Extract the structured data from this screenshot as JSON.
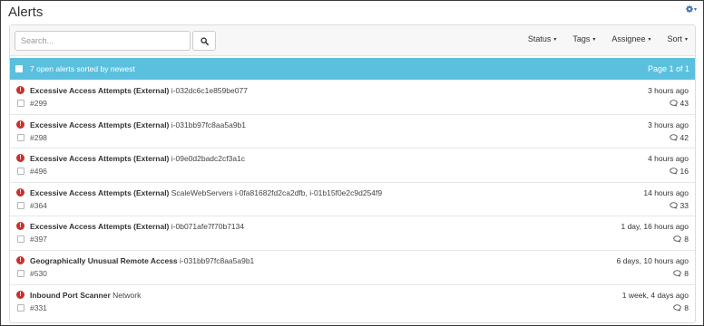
{
  "page": {
    "title": "Alerts"
  },
  "settings": {
    "icon": "gear-icon",
    "color": "#3b6fa8"
  },
  "toolbar": {
    "search_placeholder": "Search...",
    "search_icon": "search-icon",
    "filters": [
      "Status",
      "Tags",
      "Assignee",
      "Sort"
    ]
  },
  "summary": {
    "text": "7 open alerts sorted by newest",
    "page_info": "Page 1 of 1",
    "color": "#5bc0de"
  },
  "alerts": [
    {
      "name": "Excessive Access Attempts (External)",
      "detail": "i-032dc6c1e859be077",
      "number": "#299",
      "time": "3 hours ago",
      "comments": "43"
    },
    {
      "name": "Excessive Access Attempts (External)",
      "detail": "i-031bb97fc8aa5a9b1",
      "number": "#298",
      "time": "3 hours ago",
      "comments": "42"
    },
    {
      "name": "Excessive Access Attempts (External)",
      "detail": "i-09e0d2badc2cf3a1c",
      "number": "#496",
      "time": "4 hours ago",
      "comments": "16"
    },
    {
      "name": "Excessive Access Attempts (External)",
      "detail": "ScaleWebServers i-0fa81682fd2ca2dfb, i-01b15f0e2c9d254f9",
      "number": "#364",
      "time": "14 hours ago",
      "comments": "33"
    },
    {
      "name": "Excessive Access Attempts (External)",
      "detail": "i-0b071afe7f70b7134",
      "number": "#397",
      "time": "1 day, 16 hours ago",
      "comments": "8"
    },
    {
      "name": "Geographically Unusual Remote Access",
      "detail": "i-031bb97fc8aa5a9b1",
      "number": "#530",
      "time": "6 days, 10 hours ago",
      "comments": "8"
    },
    {
      "name": "Inbound Port Scanner",
      "detail": "Network",
      "number": "#331",
      "time": "1 week, 4 days ago",
      "comments": "8"
    }
  ],
  "colors": {
    "alert_icon": "#c9302c",
    "summary_bar": "#5bc0de"
  }
}
